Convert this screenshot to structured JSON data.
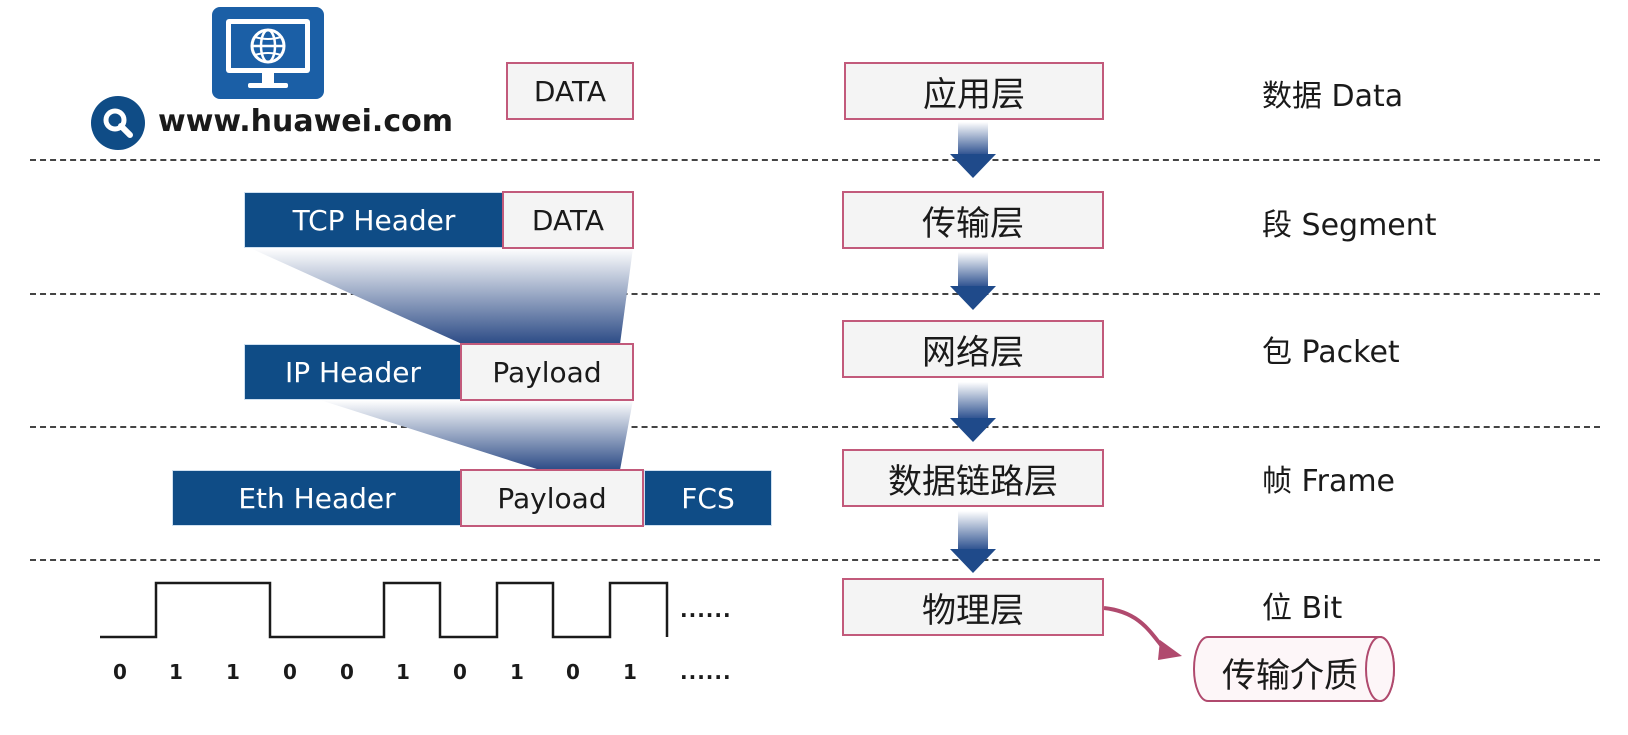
{
  "site": {
    "url": "www.huawei.com"
  },
  "layers": [
    {
      "name": "应用层",
      "pdu": "数据 Data"
    },
    {
      "name": "传输层",
      "pdu": "段 Segment"
    },
    {
      "name": "网络层",
      "pdu": "包 Packet"
    },
    {
      "name": "数据链路层",
      "pdu": "帧 Frame"
    },
    {
      "name": "物理层",
      "pdu": "位 Bit"
    }
  ],
  "encapsulation": {
    "app": {
      "data": "DATA"
    },
    "transport": {
      "header": "TCP Header",
      "data": "DATA"
    },
    "network": {
      "header": "IP Header",
      "payload": "Payload"
    },
    "datalink": {
      "header": "Eth Header",
      "payload": "Payload",
      "trailer": "FCS"
    }
  },
  "bits": {
    "values": [
      "0",
      "1",
      "1",
      "0",
      "0",
      "1",
      "0",
      "1",
      "0",
      "1"
    ],
    "ellipsis": "......"
  },
  "medium": "传输介质",
  "colors": {
    "dark_blue": "#0f4c86",
    "pink_border": "#c25a7b",
    "light_fill": "#f4f4f4"
  }
}
